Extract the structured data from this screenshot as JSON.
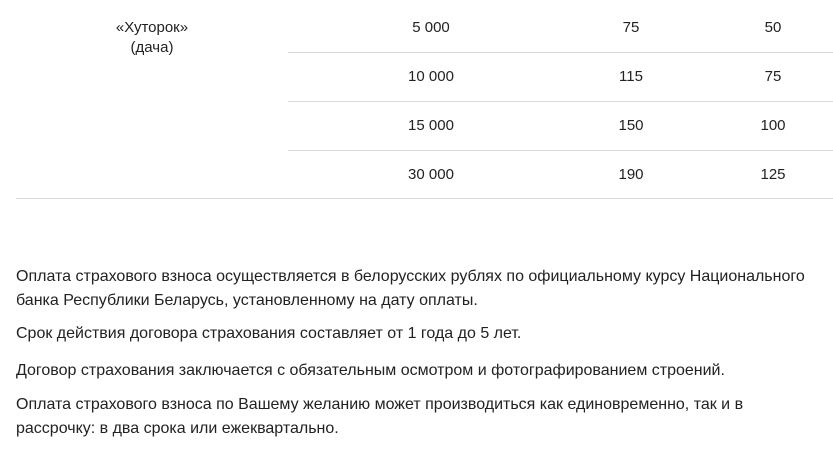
{
  "table": {
    "object_label": [
      "«Хуторок»",
      "(дача)"
    ],
    "rows": [
      {
        "sum": "5 000",
        "col2": "75",
        "col3": "50"
      },
      {
        "sum": "10 000",
        "col2": "115",
        "col3": "75"
      },
      {
        "sum": "15 000",
        "col2": "150",
        "col3": "100"
      },
      {
        "sum": "30 000",
        "col2": "190",
        "col3": "125"
      }
    ]
  },
  "notes": [
    "Оплата страхового взноса осуществляется в белорусских рублях по официальному курсу Национального банка Республики Беларусь, установленному на дату оплаты.",
    "Срок действия договора страхования составляет от 1 года до 5 лет.",
    "Договор страхования заключается с обязательным осмотром и фотографированием строений.",
    "Оплата страхового взноса по Вашему желанию может производиться как единовременно, так и в рассрочку: в два срока или ежеквартально."
  ]
}
